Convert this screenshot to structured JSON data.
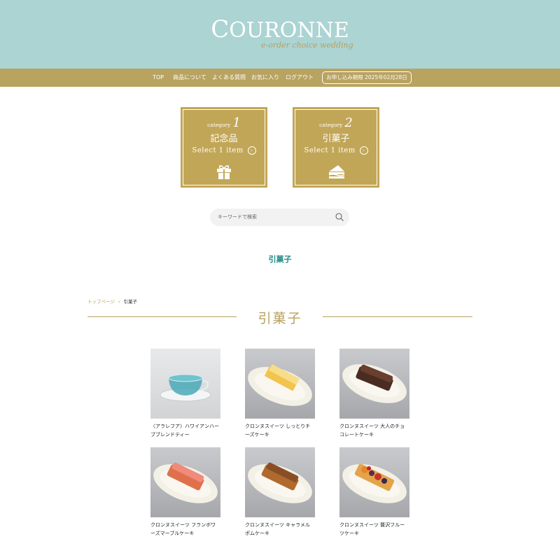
{
  "header": {
    "logo_first": "C",
    "logo_rest": "OURONNE",
    "logo_sub": "e-order choice wedding",
    "colors": {
      "header_bg": "#abd4d3",
      "nav_bg": "#b9a361",
      "gold": "#c2a657",
      "teal": "#1f8a86"
    }
  },
  "nav": {
    "items": [
      "TOP",
      "商品について",
      "よくある質問",
      "お気に入り",
      "ログアウト"
    ],
    "deadline": "お申し込み期限 2025年02月28日"
  },
  "categories": [
    {
      "small": "category",
      "num": "1",
      "name": "記念品",
      "select": "Select 1 item",
      "icon": "gift-icon"
    },
    {
      "small": "category",
      "num": "2",
      "name": "引菓子",
      "select": "Select 1 item",
      "icon": "cake-icon"
    }
  ],
  "search": {
    "placeholder": "キーワードで検索",
    "icon": "search-icon"
  },
  "selected_category": "引菓子",
  "breadcrumb": {
    "home": "トップページ",
    "sep": "›",
    "current": "引菓子"
  },
  "section_title": "引菓子",
  "products": [
    {
      "name_line1": "〈アラレフア〉ハワイアンハー",
      "name_line2": "ブブレンドティー",
      "type": "tea"
    },
    {
      "name_line1": "クロンヌスイーツ しっとりチ",
      "name_line2": "ーズケーキ",
      "type": "cheese"
    },
    {
      "name_line1": "クロンヌスイーツ 大人のチョ",
      "name_line2": "コレートケーキ",
      "type": "choco"
    },
    {
      "name_line1": "クロンヌスイーツ フランボワ",
      "name_line2": "ーズマーブルケーキ",
      "type": "framboise"
    },
    {
      "name_line1": "クロンヌスイーツ キャラメル",
      "name_line2": "ポムケーキ",
      "type": "caramel"
    },
    {
      "name_line1": "クロンヌスイーツ 贅沢フルー",
      "name_line2": "ツケーキ",
      "type": "fruit"
    }
  ]
}
